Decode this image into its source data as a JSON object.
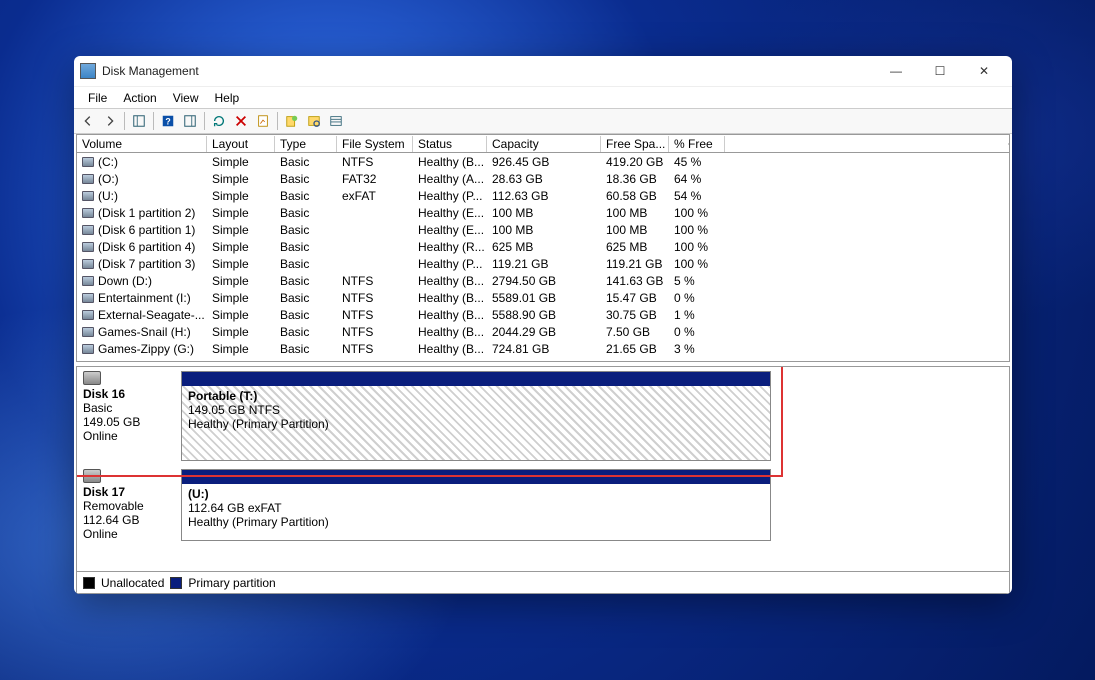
{
  "window": {
    "title": "Disk Management",
    "controls": {
      "min": "—",
      "max": "☐",
      "close": "✕"
    }
  },
  "menu": [
    "File",
    "Action",
    "View",
    "Help"
  ],
  "columns": [
    "Volume",
    "Layout",
    "Type",
    "File System",
    "Status",
    "Capacity",
    "Free Spa...",
    "% Free"
  ],
  "volumes": [
    {
      "name": "(C:)",
      "layout": "Simple",
      "type": "Basic",
      "fs": "NTFS",
      "status": "Healthy (B...",
      "cap": "926.45 GB",
      "free": "419.20 GB",
      "pct": "45 %"
    },
    {
      "name": "(O:)",
      "layout": "Simple",
      "type": "Basic",
      "fs": "FAT32",
      "status": "Healthy (A...",
      "cap": "28.63 GB",
      "free": "18.36 GB",
      "pct": "64 %"
    },
    {
      "name": "(U:)",
      "layout": "Simple",
      "type": "Basic",
      "fs": "exFAT",
      "status": "Healthy (P...",
      "cap": "112.63 GB",
      "free": "60.58 GB",
      "pct": "54 %"
    },
    {
      "name": "(Disk 1 partition 2)",
      "layout": "Simple",
      "type": "Basic",
      "fs": "",
      "status": "Healthy (E...",
      "cap": "100 MB",
      "free": "100 MB",
      "pct": "100 %"
    },
    {
      "name": "(Disk 6 partition 1)",
      "layout": "Simple",
      "type": "Basic",
      "fs": "",
      "status": "Healthy (E...",
      "cap": "100 MB",
      "free": "100 MB",
      "pct": "100 %"
    },
    {
      "name": "(Disk 6 partition 4)",
      "layout": "Simple",
      "type": "Basic",
      "fs": "",
      "status": "Healthy (R...",
      "cap": "625 MB",
      "free": "625 MB",
      "pct": "100 %"
    },
    {
      "name": "(Disk 7 partition 3)",
      "layout": "Simple",
      "type": "Basic",
      "fs": "",
      "status": "Healthy (P...",
      "cap": "119.21 GB",
      "free": "119.21 GB",
      "pct": "100 %"
    },
    {
      "name": "Down (D:)",
      "layout": "Simple",
      "type": "Basic",
      "fs": "NTFS",
      "status": "Healthy (B...",
      "cap": "2794.50 GB",
      "free": "141.63 GB",
      "pct": "5 %"
    },
    {
      "name": "Entertainment (I:)",
      "layout": "Simple",
      "type": "Basic",
      "fs": "NTFS",
      "status": "Healthy (B...",
      "cap": "5589.01 GB",
      "free": "15.47 GB",
      "pct": "0 %"
    },
    {
      "name": "External-Seagate-...",
      "layout": "Simple",
      "type": "Basic",
      "fs": "NTFS",
      "status": "Healthy (B...",
      "cap": "5588.90 GB",
      "free": "30.75 GB",
      "pct": "1 %"
    },
    {
      "name": "Games-Snail (H:)",
      "layout": "Simple",
      "type": "Basic",
      "fs": "NTFS",
      "status": "Healthy (B...",
      "cap": "2044.29 GB",
      "free": "7.50 GB",
      "pct": "0 %"
    },
    {
      "name": "Games-Zippy (G:)",
      "layout": "Simple",
      "type": "Basic",
      "fs": "NTFS",
      "status": "Healthy (B...",
      "cap": "724.81 GB",
      "free": "21.65 GB",
      "pct": "3 %"
    }
  ],
  "disks": [
    {
      "label": "Disk 16",
      "kind": "Basic",
      "size": "149.05 GB",
      "state": "Online",
      "hatch": true,
      "part_title": "Portable  (T:)",
      "part_size": "149.05 GB NTFS",
      "part_status": "Healthy (Primary Partition)"
    },
    {
      "label": "Disk 17",
      "kind": "Removable",
      "size": "112.64 GB",
      "state": "Online",
      "hatch": false,
      "part_title": "(U:)",
      "part_size": "112.64 GB exFAT",
      "part_status": "Healthy (Primary Partition)"
    }
  ],
  "legend": {
    "unalloc": "Unallocated",
    "primary": "Primary partition"
  }
}
